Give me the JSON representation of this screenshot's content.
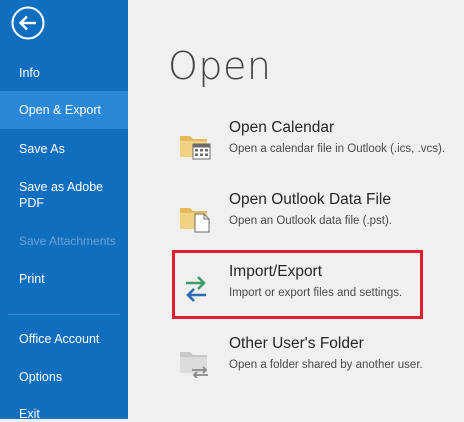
{
  "sidebar": {
    "items": [
      {
        "label": "Info"
      },
      {
        "label": "Open & Export"
      },
      {
        "label": "Save As"
      },
      {
        "label": "Save as Adobe PDF"
      },
      {
        "label": "Save Attachments"
      },
      {
        "label": "Print"
      },
      {
        "label": "Office Account"
      },
      {
        "label": "Options"
      },
      {
        "label": "Exit"
      }
    ],
    "selected": "Open & Export",
    "disabled": [
      "Save Attachments"
    ]
  },
  "main": {
    "heading": "Open",
    "options": [
      {
        "title": "Open Calendar",
        "description": "Open a calendar file in Outlook (.ics, .vcs).",
        "icon": "folder-calendar-icon"
      },
      {
        "title": "Open Outlook Data File",
        "description": "Open an Outlook data file (.pst).",
        "icon": "folder-document-icon"
      },
      {
        "title": "Import/Export",
        "description": "Import or export files and settings.",
        "icon": "import-export-arrows-icon"
      },
      {
        "title": "Other User's Folder",
        "description": "Open a folder shared by another user.",
        "icon": "shared-folder-icon"
      }
    ]
  },
  "colors": {
    "sidebar": "#106ebe",
    "selected": "#2b88d8",
    "highlight_border": "#e0202e",
    "background": "#f0f0f0"
  }
}
